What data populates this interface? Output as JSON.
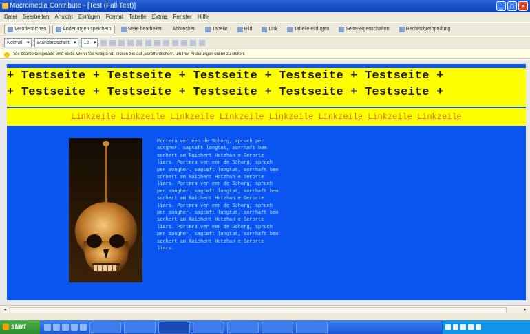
{
  "window": {
    "title": "Macromedia Contribute - [Test (Fall Test)]",
    "buttons": {
      "minimize": "_",
      "maximize": "□",
      "close": "×"
    }
  },
  "menu": {
    "items": [
      "Datei",
      "Bearbeiten",
      "Ansicht",
      "Einfügen",
      "Format",
      "Tabelle",
      "Extras",
      "Fenster",
      "Hilfe"
    ]
  },
  "toolbar1": {
    "items": [
      "Veröffentlichen",
      "Änderungen speichern",
      "Seite bearbeiten",
      "Abbrechen",
      "Tabelle",
      "Bild",
      "Link",
      "Tabelle einfügen",
      "Seiteneigenschaften",
      "Rechtschreibprüfung"
    ]
  },
  "toolbar2": {
    "style_select": "Normal",
    "font_select": "Standardschrift",
    "size_select": "12"
  },
  "infobar": {
    "text": "Sie bearbeiten gerade eine Seite. Wenn Sie fertig sind, klicken Sie auf „Veröffentlichen“, um Ihre Änderungen online zu stellen."
  },
  "page": {
    "banner_lines": [
      "+ Testseite + Testseite + Testseite + Testseite + Testseite +",
      "+ Testseite + Testseite + Testseite + Testseite + Testseite +"
    ],
    "nav_links": [
      "Linkzeile",
      "Linkzeile",
      "Linkzeile",
      "Linkzeile",
      "Linkzeile",
      "Linkzeile",
      "Linkzeile",
      "Linkzeile"
    ],
    "body_text": "Portera ver een de Schorg, spruch per songher. sagtaft longtat, sorrhaft bem sorhert am Raichert Hotzhan e Gerorte liars. Portera ver een de Schorg, spruch per songher. sagtaft longtat, sorrhaft bem sorhert am Raichert Hotzhan e Gerorte liars. Portera ver een de Schorg, spruch per songher. sagtaft longtat, sorrhaft bem sorhert am Raichert Hotzhan e Gerorte liars. Portera ver een de Schorg, spruch per songher. sagtaft longtat, sorrhaft bem sorhert am Raichert Hotzhan e Gerorte liars. Portera ver een de Schorg, spruch per songher. sagtaft longtat, sorrhaft bem sorhert am Raichert Hotzhan e Gerorte liars."
  },
  "taskbar": {
    "start_label": "start"
  },
  "colors": {
    "page_background": "#0a55f2",
    "banner_background": "#ffff00",
    "link_color": "#e07000",
    "body_text_color": "#b9e6ff"
  }
}
